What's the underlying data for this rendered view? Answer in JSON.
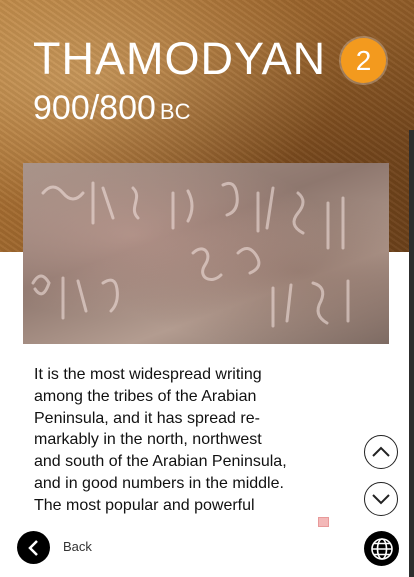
{
  "header": {
    "title": "THAMODYAN",
    "badge_number": "2",
    "date_years": "900/800",
    "date_era": "BC"
  },
  "photo": {
    "description_icon": "inscription-photo"
  },
  "content": {
    "text": "It is the most widespread writing\namong the tribes of the Arabian\nPeninsula, and it has spread re-\nmarkably in the north, northwest\nand south of the Arabian Peninsula,\nand in good numbers in the middle.\nThe most popular and powerful"
  },
  "navigation": {
    "back_label": "Back",
    "scroll_up_icon": "chevron-up-icon",
    "scroll_down_icon": "chevron-down-icon",
    "language_icon": "globe-icon"
  },
  "colors": {
    "badge": "#f39a1e",
    "header_sand": "#a26a2f",
    "button": "#000000"
  }
}
